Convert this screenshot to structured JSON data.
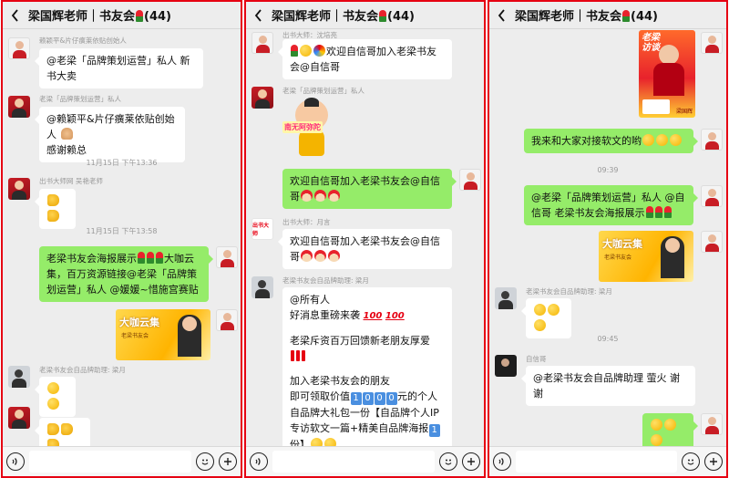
{
  "colors": {
    "frame": "#e60012",
    "bg": "#ededed",
    "bubble_green": "#95ec69",
    "bubble_white": "#ffffff",
    "meta": "#999999"
  },
  "header": {
    "title": "梁国辉老师｜书友会",
    "count": "(44)"
  },
  "icons": [
    "back-arrow-icon",
    "voice-icon",
    "emoji-icon",
    "plus-icon",
    "rose-emoji-icon",
    "thumbs-up-emoji-icon",
    "smile-emoji-icon",
    "santa-emoji-icon",
    "exclamation-emoji-icon",
    "pray-emoji-icon",
    "party-emoji-icon"
  ],
  "panel1": {
    "m1": {
      "nick": "赖颖平&片仔癀莱依贴创始人",
      "text": "@老梁「品牌策划运营」私人  新书大卖"
    },
    "m2": {
      "nick": "老梁「品牌策划运营」私人",
      "text_a": "@赖颖平&片仔癀莱依贴创始人",
      "text_b": "感谢赖总"
    },
    "ts1": "11月15日 下午13:36",
    "m3": {
      "nick": "出书大师网  吴艳老师"
    },
    "ts2": "11月15日 下午13:58",
    "m4": {
      "text_a": "老梁书友会海报展示",
      "text_b": "大咖云集，百万资源链接@老梁「品牌策划运营」私人 @媛媛~惜施宫赛贴"
    },
    "m5": {
      "poster_title": "大咖云集",
      "poster_sub": "老梁书友会"
    },
    "m6": {
      "nick": "老梁书友会自品牌助理: 梁月"
    }
  },
  "panel2": {
    "m1": {
      "nick": "出书大师：沈培亮",
      "text_a": "欢迎自信哥加入老梁书友会",
      "text_b": "@自信哥"
    },
    "m2": {
      "nick": "老梁「品牌策划运营」私人",
      "sticker_text": "南无阿弥陀"
    },
    "m3": {
      "text": "欢迎自信哥加入老梁书友会@自信哥"
    },
    "m4": {
      "nick": "出书大师：月言",
      "text": "欢迎自信哥加入老梁书友会@自信哥"
    },
    "m5": {
      "nick": "老梁书友会自品牌助理: 梁月",
      "line1": "@所有人",
      "line2": "好消息重磅来袭",
      "hundred": "100",
      "line3": "老梁斥资百万回馈新老朋友厚爱",
      "line4": "加入老梁书友会的朋友",
      "line5a": "即可领取价值",
      "digits": [
        "1",
        "0",
        "0",
        "0"
      ],
      "line5b": "元的个人自品牌大礼包一份【自品牌个人IP专访软文一篇+精美自品牌海报",
      "line5c": "份】"
    },
    "avatar_logo": "出书大师"
  },
  "panel3": {
    "m1": {
      "poster_title": "老梁\n访谈",
      "poster_sub": "梁国辉"
    },
    "m2": {
      "text": "我来和大家对接软文的哟"
    },
    "ts1": "09:39",
    "m3": {
      "text_a": "@老梁「品牌策划运营」私人  @自信哥  老梁书友会海报展示"
    },
    "m4": {
      "poster_title": "大咖云集",
      "poster_sub": "老梁书友会"
    },
    "m5": {
      "nick": "老梁书友会自品牌助理: 梁月"
    },
    "ts2": "09:45",
    "m6": {
      "nick": "自信哥",
      "text": "@老梁书友会自品牌助理  萤火  谢谢"
    }
  }
}
